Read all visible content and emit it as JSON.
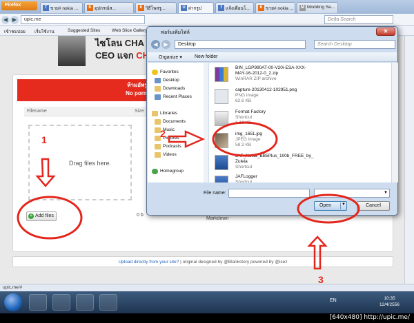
{
  "browser": {
    "app_button": "Firefox",
    "tabs": [
      "ขาย# nokia ...",
      "อุปกรณ์ส...",
      "วิธีโพสรู...",
      "ฝากรูป",
      "แจ้งเตือนโ...",
      "ขาย# nokia ...",
      "Modding Se..."
    ],
    "url": "upic.me",
    "search_placeholder": "Delta Search",
    "bookmarks": [
      "เข้าชมบ่อย",
      "เริ่มใช้งาน",
      "Suggested Sites",
      "Web Slice Gallery"
    ],
    "status": "upic.me/#"
  },
  "page": {
    "banner_title": "ไซโลน CHA",
    "banner_ceo": "CEO แจก",
    "banner_red": "CHA",
    "notice_line1": "ห้ามอัพรูปโป๊/ย",
    "notice_line2": "No pornograp",
    "col_filename": "Filename",
    "col_size": "Size",
    "drop_text": "Drag files here.",
    "add_files": "Add files",
    "zero_b": "0 b",
    "markdown": "Markdown",
    "footer_link": "Upload directly from your site?",
    "footer_rest": " | original designed by @Blankstory powered by @icez"
  },
  "dialog": {
    "title": "ฟอร์มเพิ่มไฟล์",
    "path": "Desktop",
    "search_placeholder": "Search Desktop",
    "organize": "Organize ▾",
    "new_folder": "New folder",
    "nav": {
      "favorites": "Favorites",
      "desktop": "Desktop",
      "downloads": "Downloads",
      "recent": "Recent Places",
      "libraries": "Libraries",
      "documents": "Documents",
      "music": "Music",
      "pictures": "Pictures",
      "podcasts": "Podcasts",
      "videos": "Videos",
      "homegroup": "Homegroup"
    },
    "files": [
      {
        "name": "BIN_LGP990AT-00-V20i-ESA-XXX-\nMAY-16-2012-0_2.zip",
        "type": "WinRAR ZIP archive",
        "size": ""
      },
      {
        "name": "capture-20130412-102951.png",
        "type": "PNG image",
        "size": "62.6 KB"
      },
      {
        "name": "Format Factory",
        "type": "Shortcut",
        "size": "1.13 KB"
      },
      {
        "name": "img_1651.jpg",
        "type": "JPEG image",
        "size": "58.3 KB"
      },
      {
        "name": "JAF_Nokia_BB5Plus_100b_FREE_by_\nZuleia",
        "type": "Shortcut",
        "size": ""
      },
      {
        "name": "JAFLogger",
        "type": "Shortcut",
        "size": ""
      }
    ],
    "filename_label": "File name:",
    "open": "Open",
    "cancel": "Cancel"
  },
  "annotations": {
    "step1": "1",
    "step2": "2",
    "step3": "3"
  },
  "taskbar": {
    "lang": "EN",
    "time": "10:35",
    "date": "12/4/2556"
  },
  "watermark": "[640x480] http://upic.me/",
  "colors": {
    "annotation": "#e3261c",
    "notice": "#e52b1d"
  }
}
